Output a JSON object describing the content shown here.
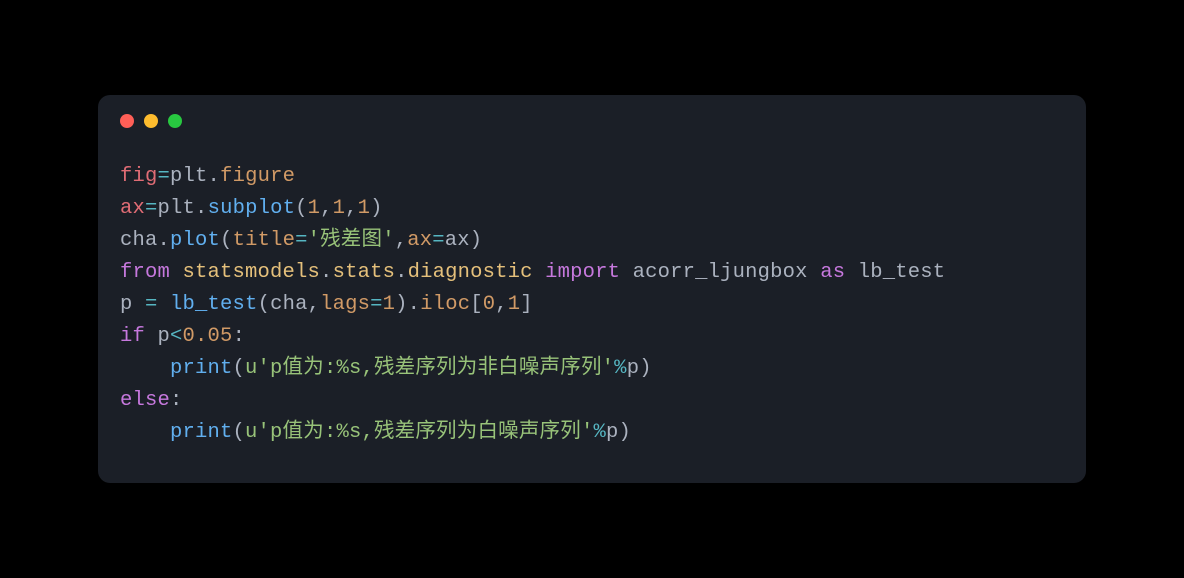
{
  "code": {
    "t1": "fig",
    "t2": "=",
    "t3": "plt",
    "t4": ".",
    "t5": "figure",
    "t6": "ax",
    "t7": "=",
    "t8": "plt",
    "t9": ".",
    "t10": "subplot",
    "t11": "(",
    "t12": "1",
    "t13": ",",
    "t14": "1",
    "t15": ",",
    "t16": "1",
    "t17": ")",
    "t18": "cha",
    "t19": ".",
    "t20": "plot",
    "t21": "(",
    "t22": "title",
    "t23": "=",
    "t24": "'残差图'",
    "t25": ",",
    "t26": "ax",
    "t27": "=",
    "t28": "ax",
    "t29": ")",
    "t30": "from",
    "t31": " statsmodels",
    "t32": ".",
    "t33": "stats",
    "t34": ".",
    "t35": "diagnostic ",
    "t36": "import",
    "t37": " acorr_ljungbox ",
    "t38": "as",
    "t39": " lb_test",
    "t40": "p ",
    "t41": "=",
    "t42": " ",
    "t43": "lb_test",
    "t44": "(",
    "t45": "cha",
    "t46": ",",
    "t47": "lags",
    "t48": "=",
    "t49": "1",
    "t50": ")",
    "t51": ".",
    "t52": "iloc",
    "t53": "[",
    "t54": "0",
    "t55": ",",
    "t56": "1",
    "t57": "]",
    "t58": "if",
    "t59": " p",
    "t60": "<",
    "t61": "0.05",
    "t62": ":",
    "t63": "    ",
    "t64": "print",
    "t65": "(",
    "t66": "u'p值为:%s,残差序列为非白噪声序列'",
    "t67": "%",
    "t68": "p",
    "t69": ")",
    "t70": "else",
    "t71": ":",
    "t72": "    ",
    "t73": "print",
    "t74": "(",
    "t75": "u'p值为:%s,残差序列为白噪声序列'",
    "t76": "%",
    "t77": "p",
    "t78": ")"
  }
}
